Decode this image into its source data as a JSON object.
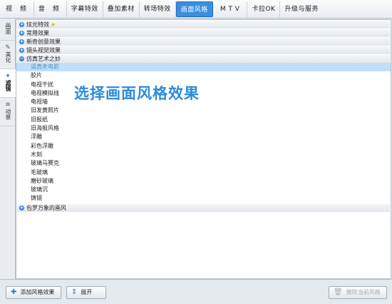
{
  "tabs": [
    {
      "label": "视 频",
      "active": false
    },
    {
      "label": "音 频",
      "active": false
    },
    {
      "label": "字幕特效",
      "active": false
    },
    {
      "label": "叠加素材",
      "active": false
    },
    {
      "label": "转场特效",
      "active": false
    },
    {
      "label": "画面风格",
      "active": true
    },
    {
      "label": "M T V",
      "active": false
    },
    {
      "label": "卡拉OK",
      "active": false
    },
    {
      "label": "升级与服务",
      "active": false
    }
  ],
  "side_nav": [
    {
      "label": "画面",
      "icon": "picture-icon",
      "active": false
    },
    {
      "label": "美化",
      "icon": "magic-wand-icon",
      "active": false
    },
    {
      "label": "滤镜",
      "icon": "filter-wand-icon",
      "active": true
    },
    {
      "label": "动景",
      "icon": "wave-icon",
      "active": false
    }
  ],
  "categories": [
    {
      "label": "炫光特效",
      "expanded": false,
      "star": true
    },
    {
      "label": "常用效果",
      "expanded": false
    },
    {
      "label": "新奇创意效果",
      "expanded": false
    },
    {
      "label": "镜头视觉效果",
      "expanded": false
    },
    {
      "label": "仿真艺术之妙",
      "expanded": true
    }
  ],
  "effects": [
    {
      "label": "逼真老电影",
      "selected": true
    },
    {
      "label": "胶片"
    },
    {
      "label": "电视干扰"
    },
    {
      "label": "电视模拟线"
    },
    {
      "label": "电视墙"
    },
    {
      "label": "旧发黄照片"
    },
    {
      "label": "旧报纸"
    },
    {
      "label": "旧海报风格"
    },
    {
      "label": "浮雕"
    },
    {
      "label": "彩色浮雕"
    },
    {
      "label": "木刻"
    },
    {
      "label": "玻璃马赛克"
    },
    {
      "label": "毛玻璃"
    },
    {
      "label": "磨砂玻璃"
    },
    {
      "label": "玻璃沉"
    },
    {
      "label": "铸镜"
    }
  ],
  "last_category": {
    "label": "包罗万象的画风",
    "expanded": false
  },
  "overlay_caption": "选择画面风格效果",
  "bottom": {
    "add_label": "添加风格效果",
    "expand_label": "展开",
    "delete_label": "删除当前风格"
  },
  "colors": {
    "accent": "#3a8ee0",
    "selected_row": "#bfe0f8",
    "overlay_text": "#2d8ad9"
  }
}
